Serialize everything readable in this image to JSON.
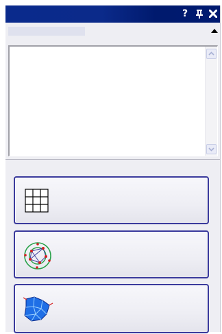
{
  "panel": {
    "title": "",
    "controls": {
      "help_label": "?",
      "pin_label": "†",
      "close_label": "✖"
    },
    "collapse_section": {
      "label": "",
      "state": "expanded"
    },
    "text_area": {
      "value": ""
    },
    "tools": [
      {
        "label": "",
        "icon": "grid-icon"
      },
      {
        "label": "",
        "icon": "circle-points-icon"
      },
      {
        "label": "",
        "icon": "blue-mesh-icon"
      }
    ]
  },
  "colors": {
    "titlebar": "#0a2a8c",
    "panel_bg": "#eeeef3",
    "button_border": "#3a3a9c",
    "mesh_fill": "#1f6fe6",
    "circle_green": "#2aa24a",
    "point_red": "#d42020"
  }
}
